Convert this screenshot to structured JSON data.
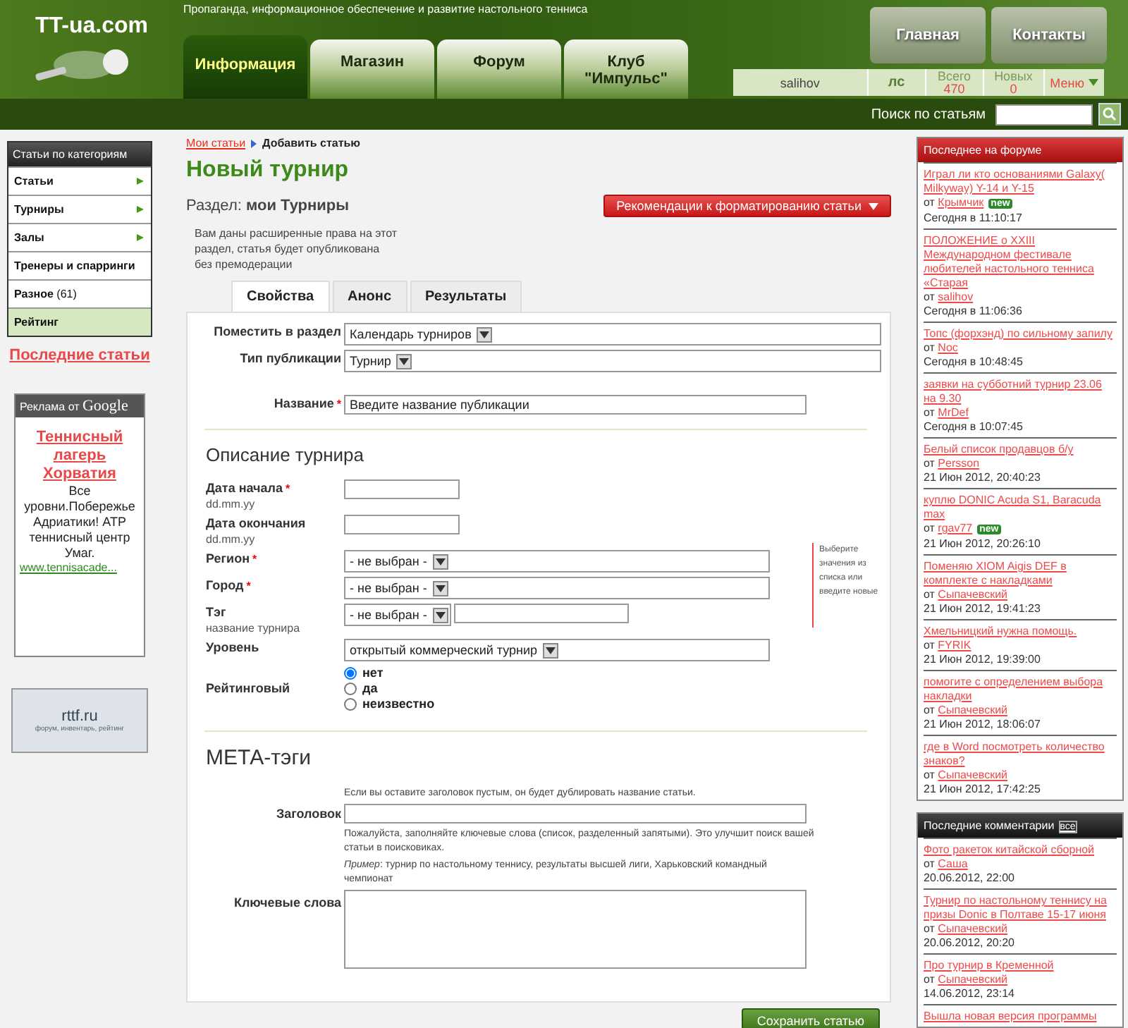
{
  "header": {
    "logo": "TT-ua.com",
    "tagline": "Пропаганда, информационное обеспечение и развитие настольного тенниса",
    "nav_tabs": [
      {
        "label": "Информация",
        "selected": true
      },
      {
        "label": "Магазин",
        "selected": false
      },
      {
        "label": "Форум",
        "selected": false
      },
      {
        "label": "Клуб\n\"Импульс\"",
        "selected": false
      }
    ],
    "top_buttons": [
      "Главная",
      "Контакты"
    ],
    "user": {
      "name": "salihov",
      "messages": "лс",
      "total_label": "Всего",
      "total": "470",
      "new_label": "Новых",
      "new": "0",
      "menu": "Меню"
    },
    "search": {
      "label": "Поиск по статьям"
    }
  },
  "left": {
    "categories": {
      "title": "Статьи по категориям",
      "items": [
        {
          "label": "Статьи",
          "arrow": true,
          "selected": false
        },
        {
          "label": "Турниры",
          "arrow": true,
          "selected": false
        },
        {
          "label": "Залы",
          "arrow": true,
          "selected": false
        },
        {
          "label": "Тренеры и спарринги",
          "arrow": false,
          "selected": false
        },
        {
          "label": "Разное",
          "count": "(61)",
          "arrow": false,
          "selected": false
        },
        {
          "label": "Рейтинг",
          "arrow": false,
          "selected": true
        }
      ]
    },
    "last_articles": "Последние статьи",
    "ad": {
      "label": "Реклама от",
      "brand": "Google",
      "title": "Теннисный лагерь Хорватия",
      "text": "Все уровни.Побережье Адриатики! ATP теннисный центр Умаг.",
      "url": "www.tennisacade..."
    },
    "banner": {
      "title": "rttf.ru",
      "subtitle": "форум, инвентарь, рейтинг"
    }
  },
  "main": {
    "breadcrumb": [
      {
        "label": "Мои статьи",
        "link": true
      },
      {
        "label": "Добавить статью",
        "link": false
      }
    ],
    "title": "Новый турнир",
    "section_label": "Раздел:",
    "section_value": "мои Турниры",
    "format_button": "Рекомендации к форматированию статьи",
    "notice": "Вам даны расширенные права на этот раздел, статья будет опубликована без премодерации",
    "tabs": [
      {
        "label": "Свойства",
        "selected": true
      },
      {
        "label": "Анонс",
        "selected": false
      },
      {
        "label": "Результаты",
        "selected": false
      }
    ],
    "top_fields": [
      {
        "label": "Поместить в раздел",
        "kind": "select",
        "value": "Календарь турниров"
      },
      {
        "label": "Тип публикации",
        "kind": "select",
        "value": "Турнир"
      },
      {
        "label": "Название",
        "kind": "text",
        "value": "Введите название публикации",
        "required_mark": "*"
      }
    ],
    "description": {
      "title": "Описание турнира",
      "side_note": "Выберите значения из списка или введите новые",
      "fields": [
        {
          "label": "Дата начала",
          "hint": "dd.mm.yy",
          "kind": "text",
          "required_mark": "*"
        },
        {
          "label": "Дата окончания",
          "hint": "dd.mm.yy",
          "kind": "text"
        },
        {
          "label": "Регион",
          "kind": "select",
          "value": "- не выбран -",
          "required_mark": "*"
        },
        {
          "label": "Город",
          "kind": "select",
          "value": "- не выбран -",
          "required_mark": "*"
        },
        {
          "label": "Тэг",
          "hint": "название турнира",
          "kind": "select_text",
          "value": "- не выбран -"
        },
        {
          "label": "Уровень",
          "kind": "select",
          "value": "открытый коммерческий турнир"
        },
        {
          "label": "Рейтинговый",
          "kind": "radio",
          "options": [
            {
              "label": "нет",
              "selected": true
            },
            {
              "label": "да",
              "selected": false
            },
            {
              "label": "неизвестно",
              "selected": false
            }
          ]
        }
      ]
    },
    "meta": {
      "title": "МЕТА-тэги",
      "fields": [
        {
          "label": "Заголовок",
          "kind": "text",
          "help": "Если вы оставите заголовок пустым, он будет дублировать название статьи."
        },
        {
          "label": "Ключевые слова",
          "kind": "textarea",
          "help": "Пожалуйста, заполняйте ключевые слова (список, разделенный запятыми). Это улучшит поиск вашей статьи в поисковиках.",
          "example": "*Пример*: турнир по настольному теннису, результаты высшей лиги, Харьковский командный чемпионат"
        }
      ]
    },
    "save_button": "Сохранить статью"
  },
  "right": {
    "forum": {
      "title": "Последнее на форуме",
      "items": [
        {
          "title": "Играл ли кто основаниями Galaxy( Milkyway) Y-14 и Y-15 ",
          "by": "от",
          "author": "Крымчик",
          "badge": "new",
          "time": "Сегодня в 11:10:17"
        },
        {
          "title": "ПОЛОЖЕНИЕ о XXIII Международном фестивале любителей настольного тенниса «Старая",
          "by": "от",
          "author": "salihov",
          "time": "Сегодня в 11:06:36"
        },
        {
          "title": "Топс (форхэнд) по сильному запилу",
          "by": "от",
          "author": "Noc",
          "time": "Сегодня в 10:48:45"
        },
        {
          "title": "заявки на субботний турнир 23.06 на 9.30",
          "by": "от",
          "author": "MrDef",
          "time": "Сегодня в 10:07:45"
        },
        {
          "title": "Белый список продавцов б/у",
          "by": "от",
          "author": "Persson",
          "time": "21 Июн 2012, 20:40:23"
        },
        {
          "title": "куплю DONIC Acuda S1, Baracuda max",
          "by": "от",
          "author": "rgav77",
          "badge": "new",
          "time": "21 Июн 2012, 20:26:10"
        },
        {
          "title": "Поменяю XIOM Aigis DEF в комплекте с накладками",
          "by": "от",
          "author": "Сыпачевский",
          "time": "21 Июн 2012, 19:41:23"
        },
        {
          "title": "Хмельницкий нужна помощь. ",
          "by": "от",
          "author": "FYRIK",
          "time": "21 Июн 2012, 19:39:00"
        },
        {
          "title": "помогите с определением выбора накладки",
          "by": "от",
          "author": "Сыпачевский",
          "time": "21 Июн 2012, 18:06:07"
        },
        {
          "title": "где в Word посмотреть количество знаков?",
          "by": "от",
          "author": "Сыпачевский",
          "time": "21 Июн 2012, 17:42:25"
        }
      ]
    },
    "comments": {
      "title": "Последние комментарии",
      "all": "все",
      "items": [
        {
          "title": "Фото ракеток китайской сборной",
          "by": "от",
          "author": "Саша",
          "time": "20.06.2012, 22:00"
        },
        {
          "title": "Турнир по настольному теннису на призы Donic в Полтаве 15-17 июня",
          "by": "от",
          "author": "Сыпачевский",
          "time": "20.06.2012, 20:20"
        },
        {
          "title": "Про турнир в Кременной",
          "by": "от",
          "author": "Сыпачевский",
          "time": "14.06.2012, 23:14"
        },
        {
          "title": "Вышла новая версия программы"
        }
      ]
    }
  }
}
